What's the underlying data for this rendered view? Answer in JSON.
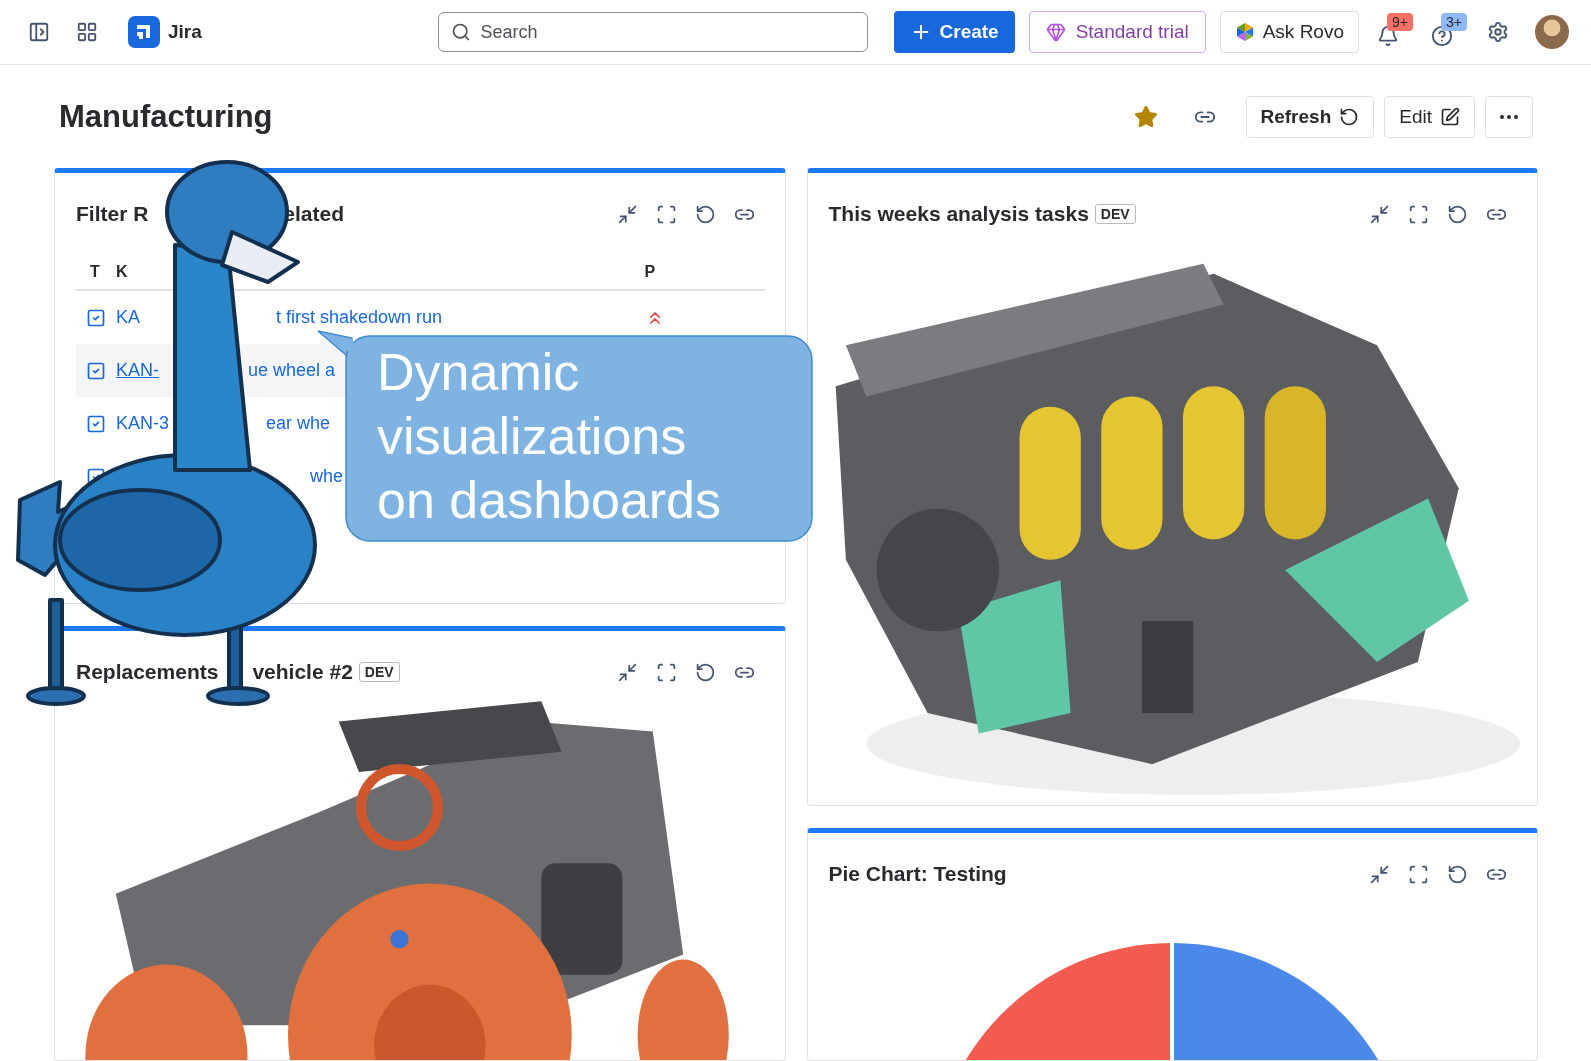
{
  "topbar": {
    "product": "Jira",
    "search": {
      "placeholder": "Search"
    },
    "create": "Create",
    "trial": "Standard trial",
    "ask": "Ask Rovo",
    "notifications": {
      "badge": "9+"
    },
    "help": {
      "badge": "3+"
    }
  },
  "dashboard": {
    "title": "Manufacturing",
    "starred": true,
    "refresh": "Refresh",
    "edit": "Edit"
  },
  "left_column": [
    {
      "kind": "table",
      "title_parts": [
        "Filter R",
        "elated"
      ],
      "columns": [
        "T",
        "K",
        "P"
      ],
      "rows": [
        {
          "kind": "task",
          "key": "KA",
          "summary": "t first shakedown run",
          "priority": {
            "kind": "highest"
          },
          "highlighted": false
        },
        {
          "kind": "task",
          "key": "KAN-",
          "summary": "ue wheel a",
          "highlighted": true
        },
        {
          "kind": "task",
          "key": "KAN-3",
          "summary": "ear whe",
          "highlighted": false
        },
        {
          "kind": "task",
          "summary": "whe"
        }
      ]
    },
    {
      "kind": "buggy",
      "title_parts": [
        "Replacements",
        "vehicle #2"
      ],
      "badge": "DEV"
    }
  ],
  "right_column": [
    {
      "kind": "engine",
      "title_parts": [
        "This weeks analysis tasks"
      ],
      "badge": "DEV"
    },
    {
      "kind": "pie",
      "title_parts": [
        "Pie Chart: Testing"
      ]
    }
  ],
  "callout": {
    "text": "Dynamic visualizations on dashboards"
  }
}
